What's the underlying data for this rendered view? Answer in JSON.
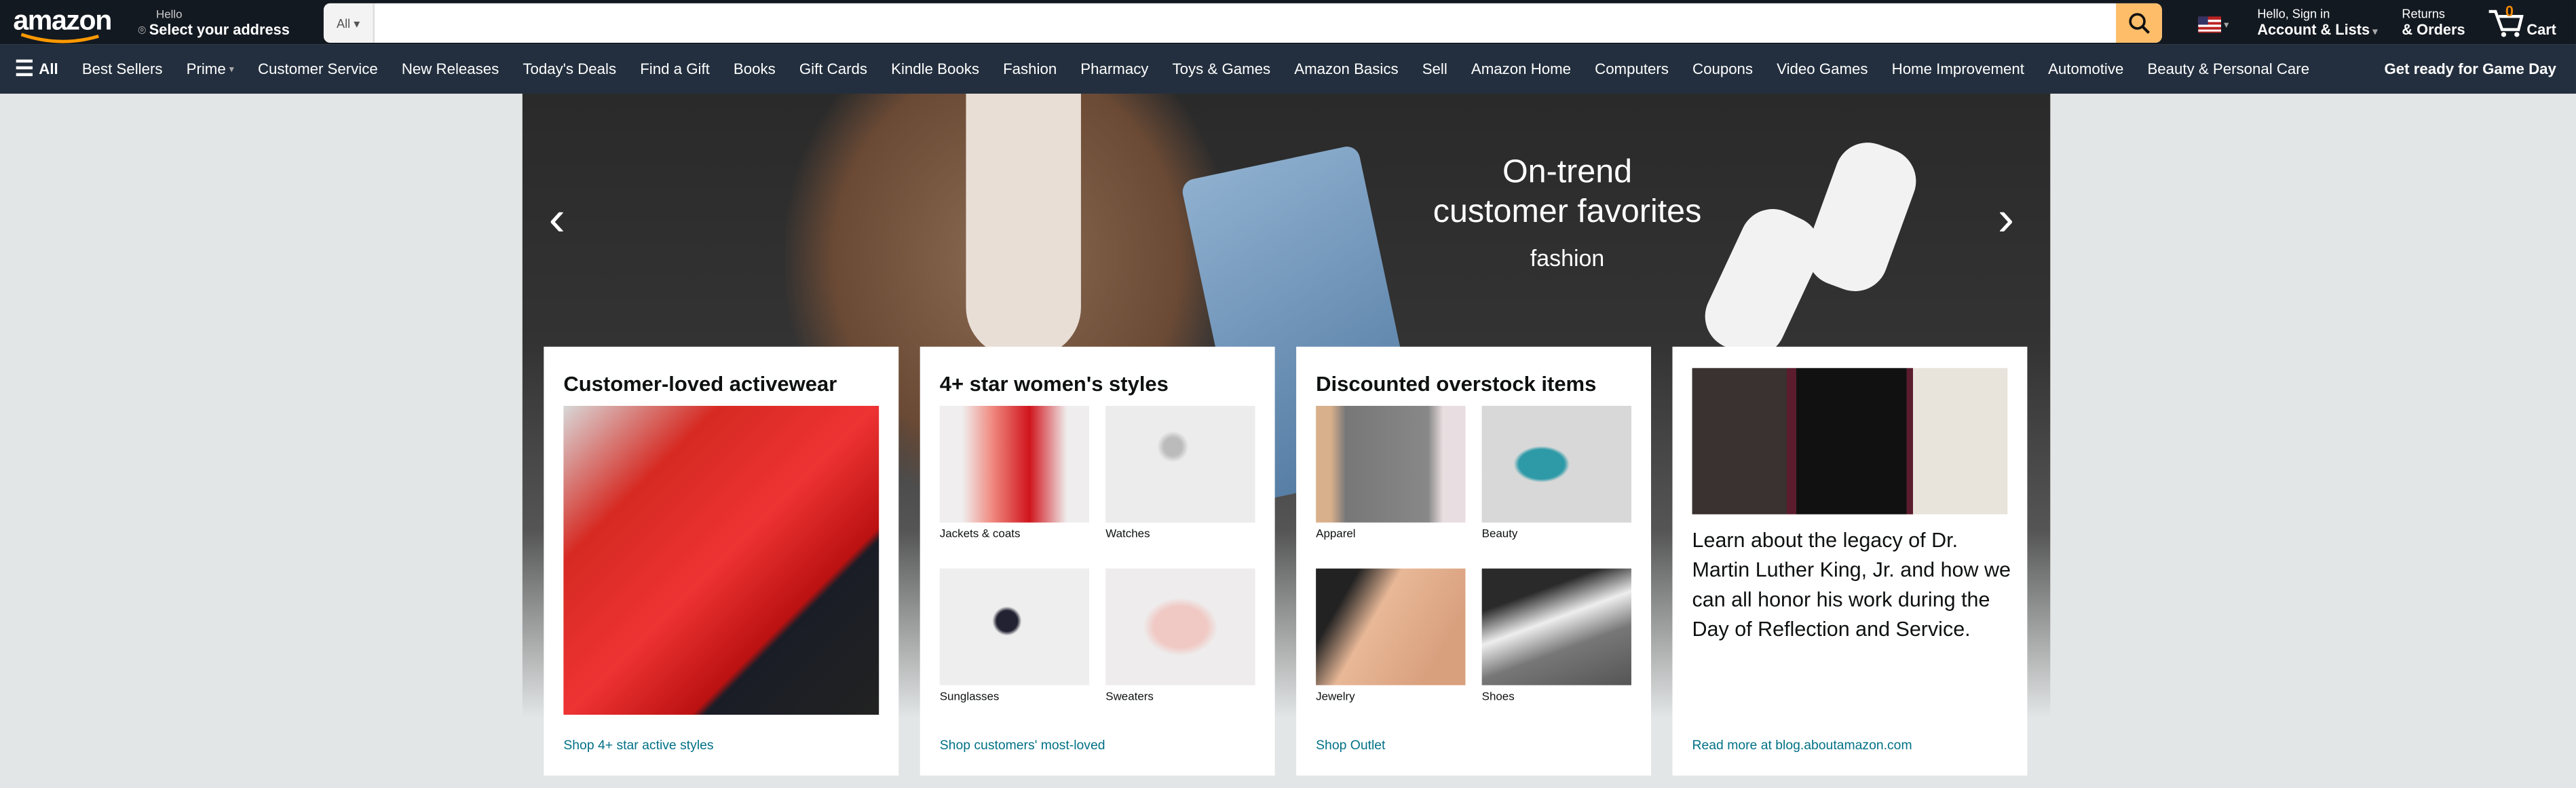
{
  "header": {
    "logo": "amazon",
    "hello": "Hello",
    "address": "Select your address",
    "search_category": "All",
    "search_placeholder": "",
    "flag": "us-flag-icon",
    "account_greeting": "Hello, Sign in",
    "account_label": "Account & Lists",
    "returns": "Returns",
    "orders": "& Orders",
    "cart_count": "0",
    "cart_label": "Cart"
  },
  "nav": {
    "all": "All",
    "items": [
      "Best Sellers",
      "Prime",
      "Customer Service",
      "New Releases",
      "Today's Deals",
      "Find a Gift",
      "Books",
      "Gift Cards",
      "Kindle Books",
      "Fashion",
      "Pharmacy",
      "Toys & Games",
      "Amazon Basics",
      "Sell",
      "Amazon Home",
      "Computers",
      "Coupons",
      "Video Games",
      "Home Improvement",
      "Automotive",
      "Beauty & Personal Care"
    ],
    "promo": "Get ready for Game Day"
  },
  "hero": {
    "headline_1": "On-trend",
    "headline_2": "customer favorites",
    "brand": "fashion"
  },
  "cards": [
    {
      "title": "Customer-loved activewear",
      "link": "Shop 4+ star active styles"
    },
    {
      "title": "4+ star women's styles",
      "tiles": [
        "Jackets & coats",
        "Watches",
        "Sunglasses",
        "Sweaters"
      ],
      "link": "Shop customers' most-loved"
    },
    {
      "title": "Discounted overstock items",
      "tiles": [
        "Apparel",
        "Beauty",
        "Jewelry",
        "Shoes"
      ],
      "link": "Shop Outlet"
    },
    {
      "text": "Learn about the legacy of Dr. Martin Luther King, Jr. and how we can all honor his work during the Day of Reflection and Service.",
      "link": "Read more at blog.aboutamazon.com"
    }
  ],
  "colors": {
    "header": "#131921",
    "nav": "#232f3e",
    "search_button": "#febd69",
    "link": "#007185",
    "accent": "#ff9900"
  }
}
